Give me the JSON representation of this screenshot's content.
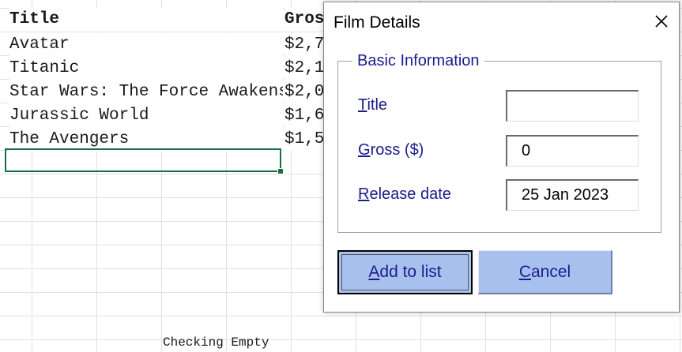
{
  "sheet": {
    "headers": {
      "title": "Title",
      "gross": "Gros"
    },
    "rows": [
      {
        "title": "Avatar",
        "gross": "$2,7"
      },
      {
        "title": "Titanic",
        "gross": "$2,1"
      },
      {
        "title": "Star Wars: The Force Awakens",
        "gross": "$2,0"
      },
      {
        "title": "Jurassic World",
        "gross": "$1,6"
      },
      {
        "title": "The Avengers",
        "gross": "$1,5"
      }
    ],
    "status_text": "Checking Empty"
  },
  "dialog": {
    "title": "Film Details",
    "frame_label": "Basic Information",
    "fields": {
      "title": {
        "accel": "T",
        "rest": "itle",
        "value": ""
      },
      "gross": {
        "accel": "G",
        "rest": "ross ($)",
        "value": "0"
      },
      "release": {
        "accel": "R",
        "rest": "elease date",
        "value": "25 Jan 2023"
      }
    },
    "buttons": {
      "add": {
        "accel": "A",
        "rest": "dd to list"
      },
      "cancel": {
        "accel": "C",
        "rest": "ancel"
      }
    },
    "icons": {
      "close": "close-icon"
    }
  },
  "colors": {
    "selection_border": "#1e6e44",
    "label_text": "#1c1c8c",
    "button_fill": "#a8c0ee"
  }
}
